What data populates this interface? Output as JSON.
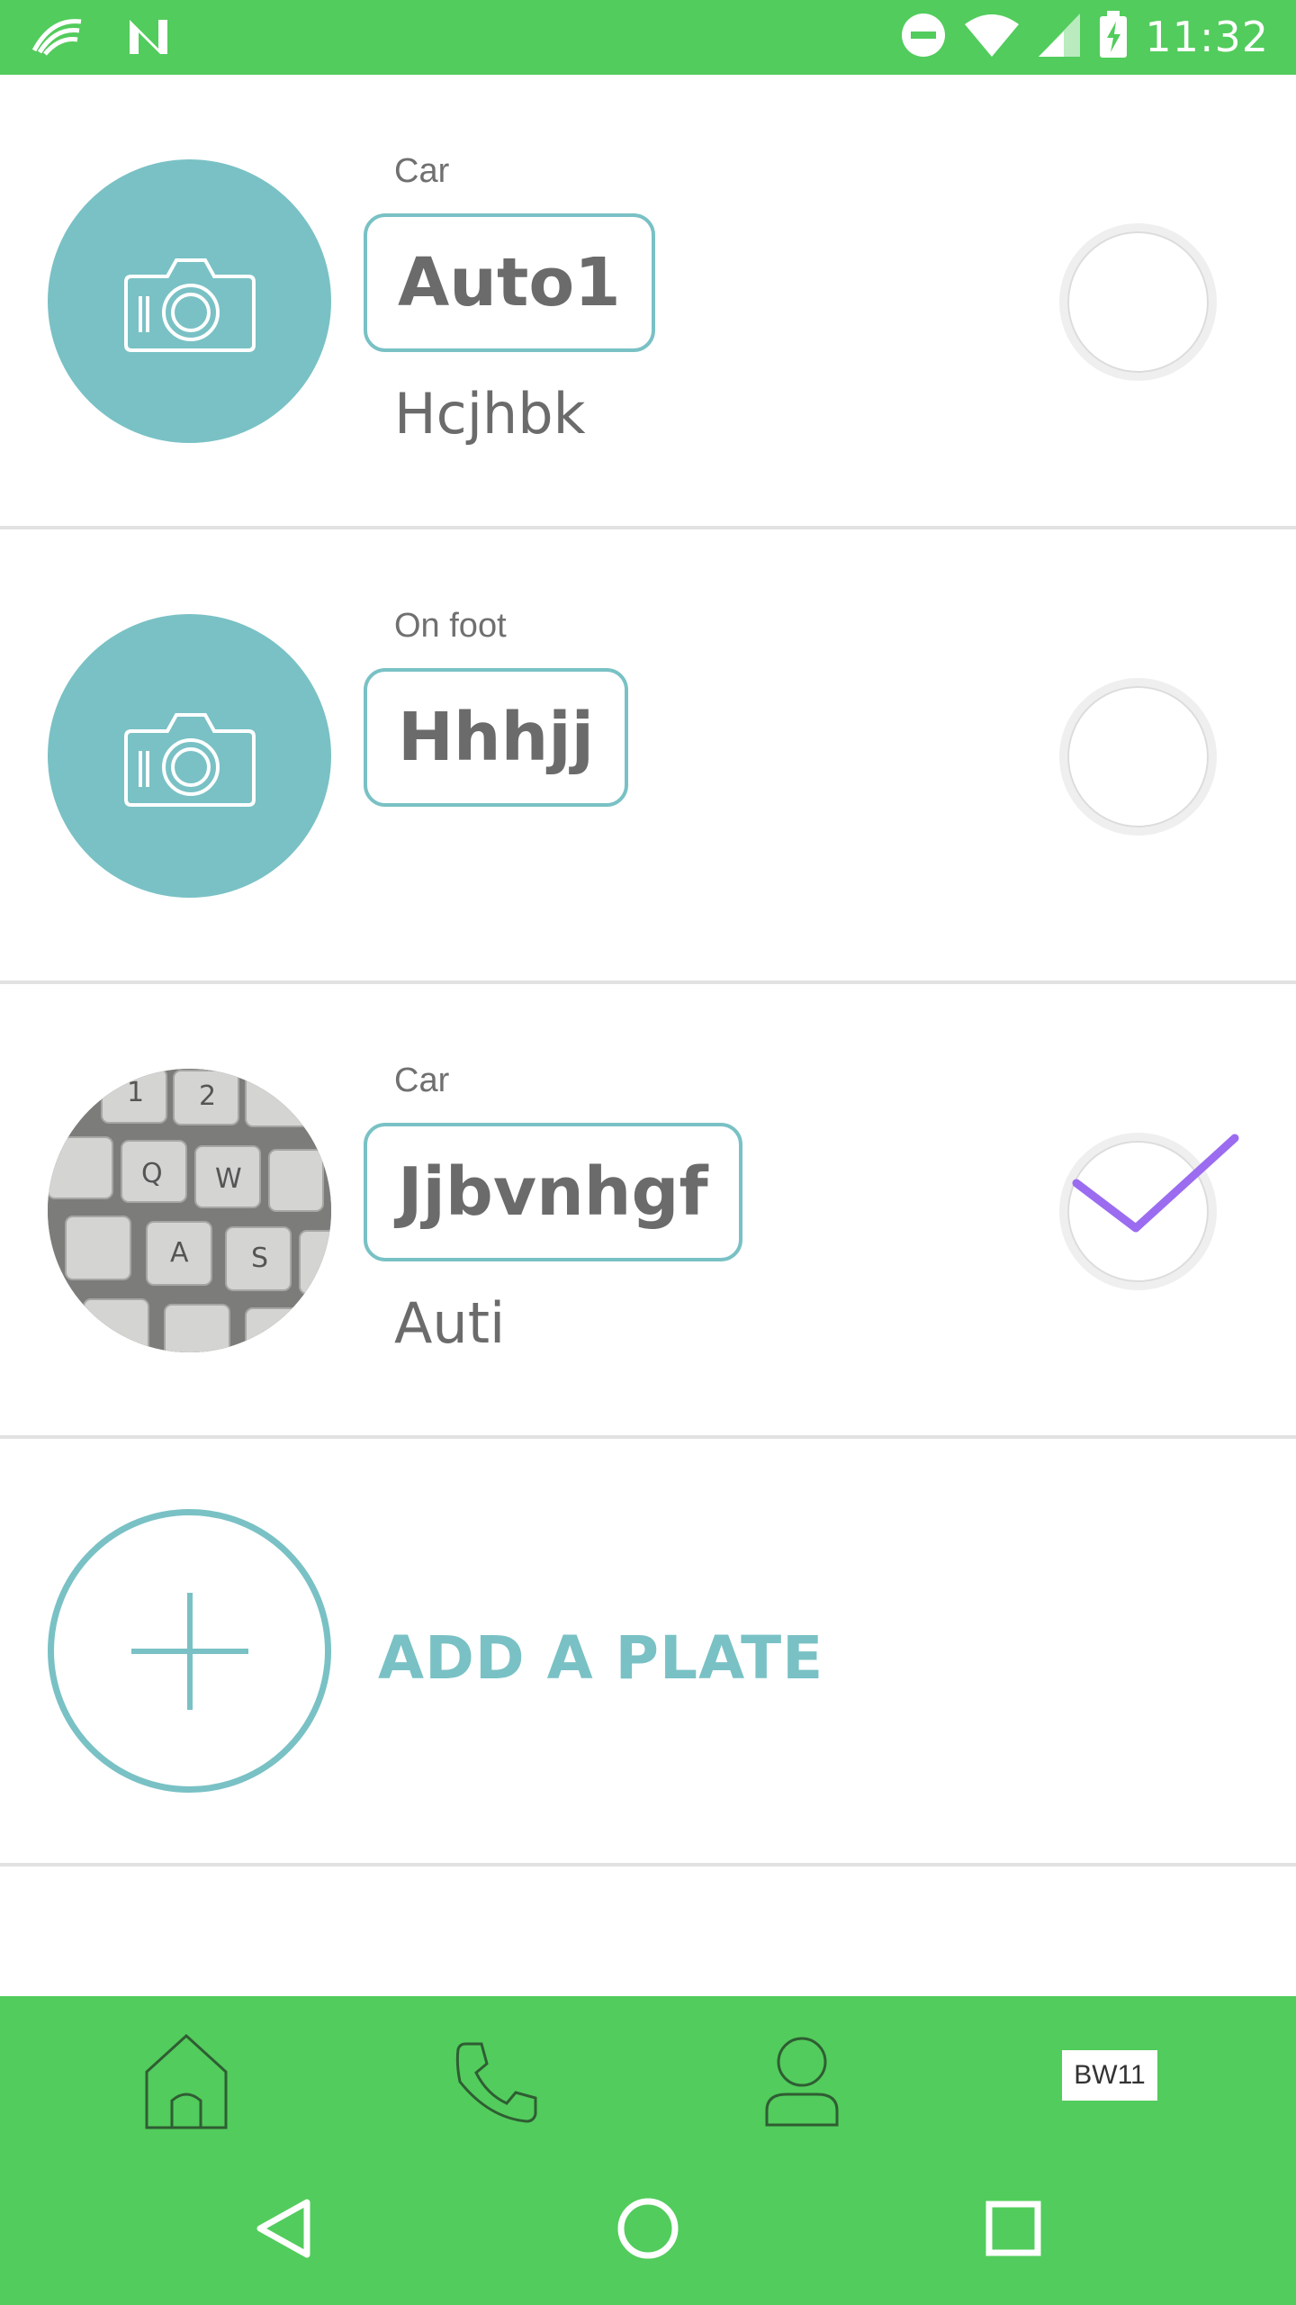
{
  "status_bar": {
    "time": "11:32",
    "icons": [
      "swiftkey-icon",
      "n-notification-icon",
      "do-not-disturb-icon",
      "wifi-icon",
      "signal-icon",
      "battery-charging-icon"
    ]
  },
  "plates": [
    {
      "vehicle_type": "Car",
      "plate": "Auto1",
      "description": "Hcjhbk",
      "has_photo": false,
      "selected": false
    },
    {
      "vehicle_type": "On foot",
      "plate": "Hhhjj",
      "description": "",
      "has_photo": false,
      "selected": false
    },
    {
      "vehicle_type": "Car",
      "plate": "Jjbvnhgf",
      "description": "Auti",
      "has_photo": true,
      "selected": true
    }
  ],
  "add_plate": {
    "label": "ADD A PLATE"
  },
  "bottom_nav": {
    "items": [
      "home-icon",
      "phone-icon",
      "profile-icon"
    ],
    "plate_chip": "BW11"
  },
  "system_nav": [
    "back-icon",
    "home-circle-icon",
    "recents-icon"
  ],
  "colors": {
    "green": "#52cc5c",
    "teal": "#79c1c5",
    "check": "#9b6cf0"
  }
}
